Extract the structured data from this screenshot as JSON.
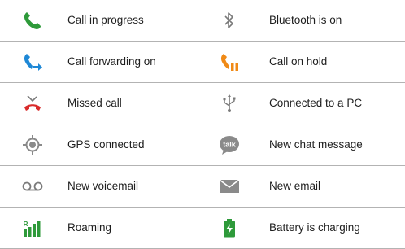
{
  "rows": [
    {
      "left": {
        "label": "Call in progress",
        "icon": "phone-green-icon"
      },
      "right": {
        "label": "Bluetooth is on",
        "icon": "bluetooth-icon"
      }
    },
    {
      "left": {
        "label": "Call forwarding on",
        "icon": "call-forward-icon"
      },
      "right": {
        "label": "Call on hold",
        "icon": "call-hold-icon"
      }
    },
    {
      "left": {
        "label": "Missed call",
        "icon": "missed-call-icon"
      },
      "right": {
        "label": "Connected to a PC",
        "icon": "usb-icon"
      }
    },
    {
      "left": {
        "label": "GPS connected",
        "icon": "gps-icon"
      },
      "right": {
        "label": "New chat message",
        "icon": "talk-chat-icon",
        "icon_text": "talk"
      }
    },
    {
      "left": {
        "label": "New voicemail",
        "icon": "voicemail-icon"
      },
      "right": {
        "label": "New email",
        "icon": "email-envelope-icon"
      }
    },
    {
      "left": {
        "label": "Roaming",
        "icon": "roaming-icon",
        "icon_text": "R"
      },
      "right": {
        "label": "Battery is charging",
        "icon": "battery-charging-icon"
      }
    }
  ],
  "colors": {
    "phone_green": "#2e9a3a",
    "forward_blue": "#1e88d6",
    "hold_orange": "#f08a16",
    "missed_red": "#d92b2b",
    "grey_icon": "#7a7a7a",
    "battery_green": "#2e9a3a",
    "divider": "#b3b3b3"
  }
}
